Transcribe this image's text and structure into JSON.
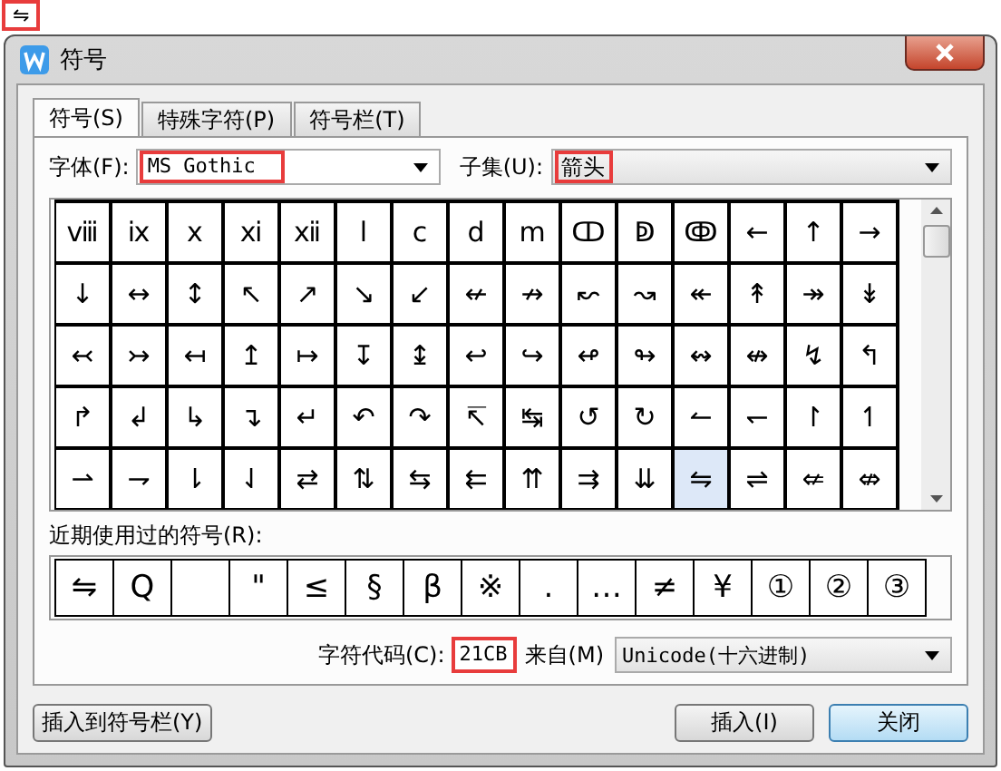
{
  "annotation": {
    "symbol": "⇋"
  },
  "window": {
    "title": "符号"
  },
  "tabs": [
    {
      "label": "符号(S)",
      "selected": true
    },
    {
      "label": "特殊字符(P)",
      "selected": false
    },
    {
      "label": "符号栏(T)",
      "selected": false
    }
  ],
  "font": {
    "label": "字体(F):",
    "value": "MS Gothic"
  },
  "subset": {
    "label": "子集(U):",
    "value": "箭头"
  },
  "symbol_grid": [
    [
      {
        "symbol": "ⅷ",
        "selected": false
      },
      {
        "symbol": "ⅸ",
        "selected": false
      },
      {
        "symbol": "ⅹ",
        "selected": false
      },
      {
        "symbol": "ⅺ",
        "selected": false
      },
      {
        "symbol": "ⅻ",
        "selected": false
      },
      {
        "symbol": "ⅼ",
        "selected": false
      },
      {
        "symbol": "ⅽ",
        "selected": false
      },
      {
        "symbol": "ⅾ",
        "selected": false
      },
      {
        "symbol": "ⅿ",
        "selected": false
      },
      {
        "symbol": "ↀ",
        "selected": false
      },
      {
        "symbol": "ↁ",
        "selected": false
      },
      {
        "symbol": "ↂ",
        "selected": false
      },
      {
        "symbol": "←",
        "selected": false
      },
      {
        "symbol": "↑",
        "selected": false
      },
      {
        "symbol": "→",
        "selected": false
      }
    ],
    [
      {
        "symbol": "↓",
        "selected": false
      },
      {
        "symbol": "↔",
        "selected": false
      },
      {
        "symbol": "↕",
        "selected": false
      },
      {
        "symbol": "↖",
        "selected": false
      },
      {
        "symbol": "↗",
        "selected": false
      },
      {
        "symbol": "↘",
        "selected": false
      },
      {
        "symbol": "↙",
        "selected": false
      },
      {
        "symbol": "↚",
        "selected": false
      },
      {
        "symbol": "↛",
        "selected": false
      },
      {
        "symbol": "↜",
        "selected": false
      },
      {
        "symbol": "↝",
        "selected": false
      },
      {
        "symbol": "↞",
        "selected": false
      },
      {
        "symbol": "↟",
        "selected": false
      },
      {
        "symbol": "↠",
        "selected": false
      },
      {
        "symbol": "↡",
        "selected": false
      }
    ],
    [
      {
        "symbol": "↢",
        "selected": false
      },
      {
        "symbol": "↣",
        "selected": false
      },
      {
        "symbol": "↤",
        "selected": false
      },
      {
        "symbol": "↥",
        "selected": false
      },
      {
        "symbol": "↦",
        "selected": false
      },
      {
        "symbol": "↧",
        "selected": false
      },
      {
        "symbol": "↨",
        "selected": false
      },
      {
        "symbol": "↩",
        "selected": false
      },
      {
        "symbol": "↪",
        "selected": false
      },
      {
        "symbol": "↫",
        "selected": false
      },
      {
        "symbol": "↬",
        "selected": false
      },
      {
        "symbol": "↭",
        "selected": false
      },
      {
        "symbol": "↮",
        "selected": false
      },
      {
        "symbol": "↯",
        "selected": false
      },
      {
        "symbol": "↰",
        "selected": false
      }
    ],
    [
      {
        "symbol": "↱",
        "selected": false
      },
      {
        "symbol": "↲",
        "selected": false
      },
      {
        "symbol": "↳",
        "selected": false
      },
      {
        "symbol": "↴",
        "selected": false
      },
      {
        "symbol": "↵",
        "selected": false
      },
      {
        "symbol": "↶",
        "selected": false
      },
      {
        "symbol": "↷",
        "selected": false
      },
      {
        "symbol": "↸",
        "selected": false
      },
      {
        "symbol": "↹",
        "selected": false
      },
      {
        "symbol": "↺",
        "selected": false
      },
      {
        "symbol": "↻",
        "selected": false
      },
      {
        "symbol": "↼",
        "selected": false
      },
      {
        "symbol": "↽",
        "selected": false
      },
      {
        "symbol": "↾",
        "selected": false
      },
      {
        "symbol": "↿",
        "selected": false
      }
    ],
    [
      {
        "symbol": "⇀",
        "selected": false
      },
      {
        "symbol": "⇁",
        "selected": false
      },
      {
        "symbol": "⇂",
        "selected": false
      },
      {
        "symbol": "⇃",
        "selected": false
      },
      {
        "symbol": "⇄",
        "selected": false
      },
      {
        "symbol": "⇅",
        "selected": false
      },
      {
        "symbol": "⇆",
        "selected": false
      },
      {
        "symbol": "⇇",
        "selected": false
      },
      {
        "symbol": "⇈",
        "selected": false
      },
      {
        "symbol": "⇉",
        "selected": false
      },
      {
        "symbol": "⇊",
        "selected": false
      },
      {
        "symbol": "⇋",
        "selected": true
      },
      {
        "symbol": "⇌",
        "selected": false
      },
      {
        "symbol": "⇍",
        "selected": false
      },
      {
        "symbol": "⇎",
        "selected": false
      }
    ]
  ],
  "recent": {
    "label": "近期使用过的符号(R):",
    "symbols": [
      {
        "kind": "symbol",
        "symbol": "⇋"
      },
      {
        "kind": "symbol",
        "symbol": "Q"
      },
      {
        "kind": "empty"
      },
      {
        "kind": "symbol",
        "symbol": "\""
      },
      {
        "kind": "symbol",
        "symbol": "≤"
      },
      {
        "kind": "symbol",
        "symbol": "§"
      },
      {
        "kind": "symbol",
        "symbol": "β"
      },
      {
        "kind": "symbol",
        "symbol": "※"
      },
      {
        "kind": "symbol",
        "symbol": "."
      },
      {
        "kind": "symbol",
        "symbol": "…"
      },
      {
        "kind": "symbol",
        "symbol": "≠"
      },
      {
        "kind": "symbol",
        "symbol": "¥"
      },
      {
        "kind": "symbol",
        "symbol": "①"
      },
      {
        "kind": "symbol",
        "symbol": "②"
      },
      {
        "kind": "symbol",
        "symbol": "③"
      }
    ]
  },
  "char_code": {
    "label": "字符代码(C):",
    "value": "21CB"
  },
  "from": {
    "label": "来自(M)",
    "value": "Unicode(十六进制)"
  },
  "buttons": [
    {
      "label": "插入到符号栏(Y)",
      "kind": "secondary"
    },
    {
      "label": "插入(I)",
      "kind": "secondary"
    },
    {
      "label": "关闭",
      "kind": "default"
    }
  ]
}
